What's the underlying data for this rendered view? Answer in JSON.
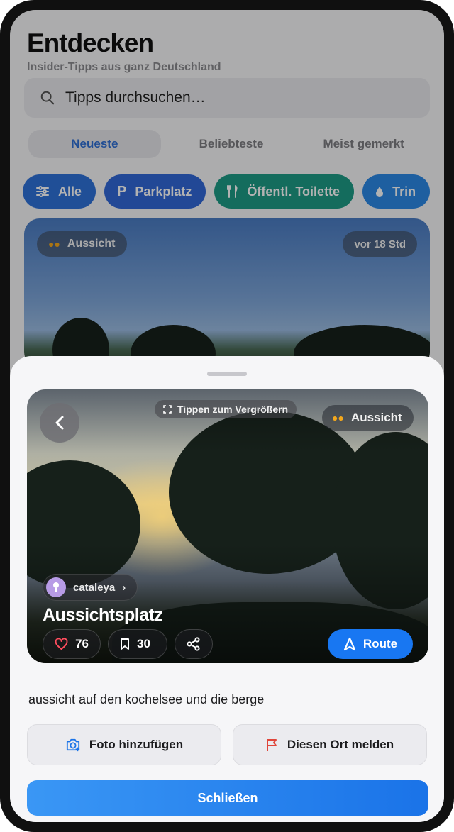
{
  "header": {
    "title": "Entdecken",
    "subtitle": "Insider-Tipps aus ganz Deutschland"
  },
  "search": {
    "placeholder": "Tipps durchsuchen…"
  },
  "sort_tabs": [
    {
      "label": "Neueste",
      "active": true
    },
    {
      "label": "Beliebteste",
      "active": false
    },
    {
      "label": "Meist gemerkt",
      "active": false
    }
  ],
  "filters": [
    {
      "label": "Alle",
      "icon": "sliders-icon",
      "color": "#2f71d9"
    },
    {
      "label": "Parkplatz",
      "icon": "parking-icon",
      "color": "#3168d7"
    },
    {
      "label": "Öffentl. Toilette",
      "icon": "restroom-icon",
      "color": "#1e9b86"
    },
    {
      "label": "Trin",
      "icon": "water-drop-icon",
      "color": "#2c89e6"
    }
  ],
  "feed_card": {
    "category": "Aussicht",
    "time_ago": "vor 18 Std"
  },
  "detail": {
    "enlarge_hint": "Tippen zum Vergrößern",
    "category": "Aussicht",
    "username": "cataleya",
    "title": "Aussichtsplatz",
    "likes": "76",
    "saves": "30",
    "route_label": "Route",
    "description": "aussicht auf den kochelsee und die berge",
    "add_photo_label": "Foto hinzufügen",
    "report_label": "Diesen Ort melden",
    "close_label": "Schließen"
  },
  "colors": {
    "accent": "#1877f2",
    "active_tab_text": "#2f6fd4",
    "report_flag": "#e0453a"
  }
}
